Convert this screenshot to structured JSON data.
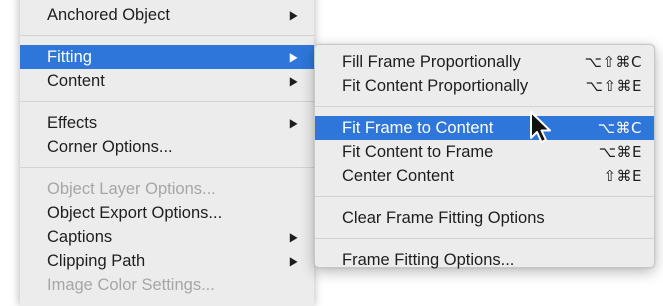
{
  "main_menu": {
    "items": [
      {
        "label": "Anchored Object",
        "arrow": "▶"
      },
      {
        "label": "Fitting",
        "arrow": "▶"
      },
      {
        "label": "Content",
        "arrow": "▶"
      },
      {
        "label": "Effects",
        "arrow": "▶"
      },
      {
        "label": "Corner Options..."
      },
      {
        "label": "Object Layer Options..."
      },
      {
        "label": "Object Export Options..."
      },
      {
        "label": "Captions",
        "arrow": "▶"
      },
      {
        "label": "Clipping Path",
        "arrow": "▶"
      },
      {
        "label": "Image Color Settings..."
      }
    ]
  },
  "sub_menu": {
    "items": [
      {
        "label": "Fill Frame Proportionally",
        "shortcut": "⌥⇧⌘C"
      },
      {
        "label": "Fit Content Proportionally",
        "shortcut": "⌥⇧⌘E"
      },
      {
        "label": "Fit Frame to Content",
        "shortcut": "⌥⌘C"
      },
      {
        "label": "Fit Content to Frame",
        "shortcut": "⌥⌘E"
      },
      {
        "label": "Center Content",
        "shortcut": "⇧⌘E"
      },
      {
        "label": "Clear Frame Fitting Options"
      },
      {
        "label": "Frame Fitting Options..."
      }
    ]
  },
  "colors": {
    "menu_background": "#ececec",
    "selection": "#2f76db",
    "disabled_text": "#a6a6a6"
  }
}
